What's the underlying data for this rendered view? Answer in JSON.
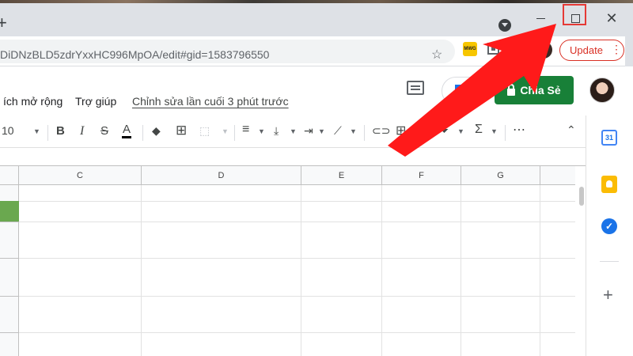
{
  "browser": {
    "url": "DiDNzBLD5zdrYxxHC996MpOA/edit#gid=1583796550",
    "update_label": "Update",
    "new_tab_glyph": "+",
    "extension_label": "MWG"
  },
  "docs": {
    "menu": [
      "ích mở rộng",
      "Trợ giúp"
    ],
    "last_edit": "Chỉnh sửa lần cuối 3 phút trước",
    "share_label": "Chia Sẻ"
  },
  "format_toolbar": {
    "font_size": "10",
    "bold": "B",
    "italic": "I",
    "strike": "S",
    "text_color": "A"
  },
  "grid": {
    "columns": [
      "C",
      "D",
      "E",
      "F",
      "G"
    ]
  },
  "side_panel": {
    "calendar_day": "31"
  },
  "colors": {
    "share_green": "#188038",
    "update_red": "#d93025",
    "annotation_red": "#e53935",
    "selected_cell_green": "#6aa84f"
  },
  "annotation": {
    "highlighted_control": "maximize-button"
  }
}
